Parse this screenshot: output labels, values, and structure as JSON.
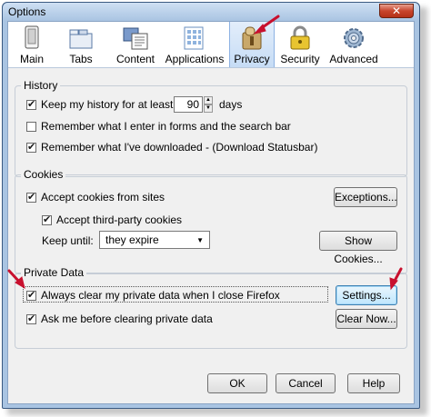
{
  "window": {
    "title": "Options",
    "close_label": "✕"
  },
  "tabs": [
    {
      "label": "Main",
      "icon": "main-icon"
    },
    {
      "label": "Tabs",
      "icon": "tabs-icon"
    },
    {
      "label": "Content",
      "icon": "content-icon"
    },
    {
      "label": "Applications",
      "icon": "applications-icon"
    },
    {
      "label": "Privacy",
      "icon": "privacy-icon",
      "selected": true
    },
    {
      "label": "Security",
      "icon": "security-icon"
    },
    {
      "label": "Advanced",
      "icon": "advanced-icon"
    }
  ],
  "history": {
    "legend": "History",
    "keep_history_label": "Keep my history for at least",
    "keep_history_days": "90",
    "days_label": "days",
    "forms_label": "Remember what I enter in forms and the search bar",
    "downloads_label": "Remember what I've downloaded - (Download Statusbar)"
  },
  "cookies": {
    "legend": "Cookies",
    "accept_label": "Accept cookies from sites",
    "third_party_label": "Accept third-party cookies",
    "keep_until_label": "Keep until:",
    "keep_until_value": "they expire",
    "exceptions_label": "Exceptions...",
    "show_cookies_label": "Show Cookies..."
  },
  "private_data": {
    "legend": "Private Data",
    "always_clear_label": "Always clear my private data when I close Firefox",
    "ask_label": "Ask me before clearing private data",
    "settings_label": "Settings...",
    "clear_now_label": "Clear Now..."
  },
  "footer": {
    "ok_label": "OK",
    "cancel_label": "Cancel",
    "help_label": "Help"
  },
  "colors": {
    "annotation_arrow": "#c8102e",
    "selected_tab": "#c6dcf5"
  }
}
